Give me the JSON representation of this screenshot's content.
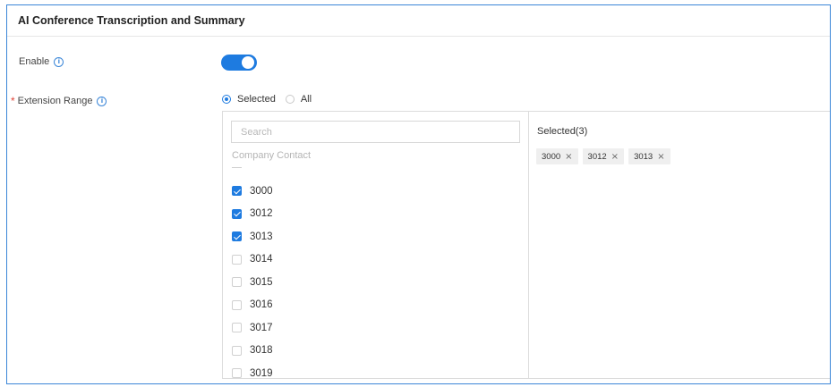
{
  "section": {
    "title": "AI Conference Transcription and Summary"
  },
  "enable": {
    "label": "Enable",
    "info_icon": "info-icon",
    "state": "on",
    "accent": "#1e7be0"
  },
  "extension_range": {
    "required_mark": "*",
    "label": "Extension Range",
    "info_icon": "info-icon",
    "options": [
      {
        "label": "Selected",
        "checked": true
      },
      {
        "label": "All",
        "checked": false
      }
    ]
  },
  "transfer": {
    "search_placeholder": "Search",
    "search_value": "",
    "group_label": "Company Contact",
    "items": [
      {
        "label": "3000",
        "checked": true
      },
      {
        "label": "3012",
        "checked": true
      },
      {
        "label": "3013",
        "checked": true
      },
      {
        "label": "3014",
        "checked": false
      },
      {
        "label": "3015",
        "checked": false
      },
      {
        "label": "3016",
        "checked": false
      },
      {
        "label": "3017",
        "checked": false
      },
      {
        "label": "3018",
        "checked": false
      },
      {
        "label": "3019",
        "checked": false
      }
    ],
    "selected_title": "Selected(3)",
    "selected_tags": [
      {
        "label": "3000",
        "close": "×"
      },
      {
        "label": "3012",
        "close": "×"
      },
      {
        "label": "3013",
        "close": "×"
      }
    ]
  },
  "colors": {
    "primary": "#1e7be0",
    "border_accent": "#3b86d8",
    "required": "#e0453a"
  }
}
